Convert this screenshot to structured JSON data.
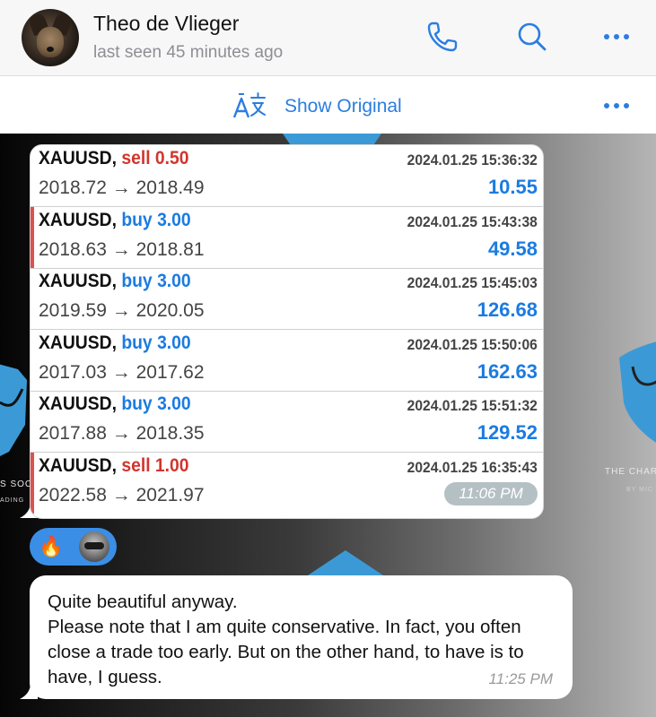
{
  "header": {
    "contact_name": "Theo de Vlieger",
    "last_seen": "last seen 45 minutes ago",
    "icons": [
      "phone-icon",
      "search-icon",
      "more-icon"
    ]
  },
  "translate_bar": {
    "label": "Show Original",
    "icons": [
      "translate-icon",
      "more-icon"
    ]
  },
  "watermark": {
    "left_text": "S SOC",
    "left_sub": "ADING",
    "right_text": "THE CHAR",
    "right_sub": "BY MIC"
  },
  "trades": [
    {
      "symbol": "XAUUSD,",
      "direction": "sell",
      "volume": "0.50",
      "open": "2018.72",
      "close": "2018.49",
      "arrow": "→",
      "timestamp": "2024.01.25 15:36:32",
      "profit": "10.55",
      "marked": false
    },
    {
      "symbol": "XAUUSD,",
      "direction": "buy",
      "volume": "3.00",
      "open": "2018.63",
      "close": "2018.81",
      "arrow": "→",
      "timestamp": "2024.01.25 15:43:38",
      "profit": "49.58",
      "marked": true
    },
    {
      "symbol": "XAUUSD,",
      "direction": "buy",
      "volume": "3.00",
      "open": "2019.59",
      "close": "2020.05",
      "arrow": "→",
      "timestamp": "2024.01.25 15:45:03",
      "profit": "126.68",
      "marked": false
    },
    {
      "symbol": "XAUUSD,",
      "direction": "buy",
      "volume": "3.00",
      "open": "2017.03",
      "close": "2017.62",
      "arrow": "→",
      "timestamp": "2024.01.25 15:50:06",
      "profit": "162.63",
      "marked": false
    },
    {
      "symbol": "XAUUSD,",
      "direction": "buy",
      "volume": "3.00",
      "open": "2017.88",
      "close": "2018.35",
      "arrow": "→",
      "timestamp": "2024.01.25 15:51:32",
      "profit": "129.52",
      "marked": false
    },
    {
      "symbol": "XAUUSD,",
      "direction": "sell",
      "volume": "1.00",
      "open": "2022.58",
      "close": "2021.97",
      "arrow": "→",
      "timestamp": "2024.01.25 16:35:43",
      "profit": "",
      "marked": true
    }
  ],
  "image_message": {
    "time": "11:06 PM"
  },
  "reactions": [
    {
      "emoji": "🔥",
      "name": "fire-reaction"
    },
    {
      "emoji": "",
      "name": "reactor-avatar"
    }
  ],
  "text_message": {
    "text": "Quite beautiful anyway.\nPlease note that I am quite conservative. In fact, you often close a trade too early. But on the other hand, to have is to have, I guess.",
    "time": "11:25 PM"
  },
  "colors": {
    "accent": "#2b7de0",
    "sell": "#d0362f",
    "buy": "#1b7be0",
    "reaction_bg": "#3a8ee6"
  }
}
